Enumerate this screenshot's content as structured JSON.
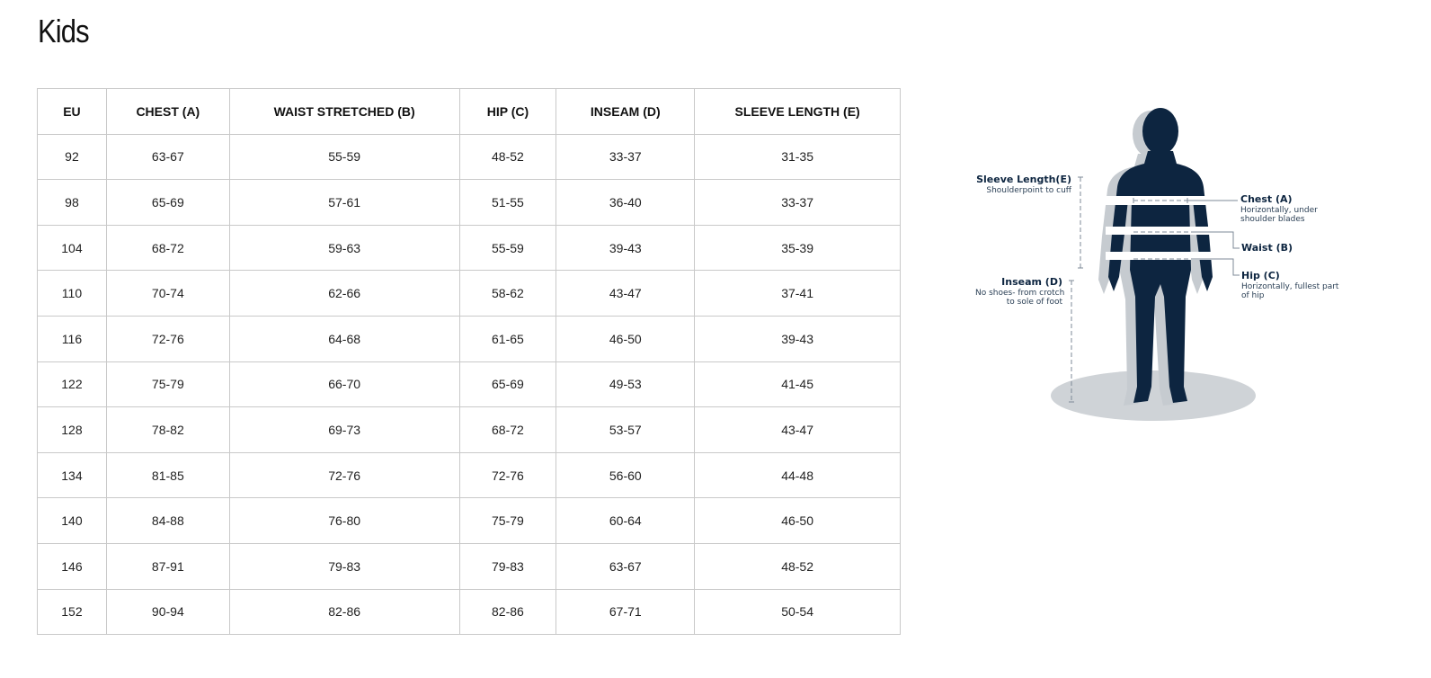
{
  "title": "Kids",
  "table": {
    "headers": [
      "EU",
      "CHEST (A)",
      "WAIST STRETCHED (B)",
      "HIP (C)",
      "INSEAM (D)",
      "SLEEVE LENGTH (E)"
    ],
    "rows": [
      [
        "92",
        "63-67",
        "55-59",
        "48-52",
        "33-37",
        "31-35"
      ],
      [
        "98",
        "65-69",
        "57-61",
        "51-55",
        "36-40",
        "33-37"
      ],
      [
        "104",
        "68-72",
        "59-63",
        "55-59",
        "39-43",
        "35-39"
      ],
      [
        "110",
        "70-74",
        "62-66",
        "58-62",
        "43-47",
        "37-41"
      ],
      [
        "116",
        "72-76",
        "64-68",
        "61-65",
        "46-50",
        "39-43"
      ],
      [
        "122",
        "75-79",
        "66-70",
        "65-69",
        "49-53",
        "41-45"
      ],
      [
        "128",
        "78-82",
        "69-73",
        "68-72",
        "53-57",
        "43-47"
      ],
      [
        "134",
        "81-85",
        "72-76",
        "72-76",
        "56-60",
        "44-48"
      ],
      [
        "140",
        "84-88",
        "76-80",
        "75-79",
        "60-64",
        "46-50"
      ],
      [
        "146",
        "87-91",
        "79-83",
        "79-83",
        "63-67",
        "48-52"
      ],
      [
        "152",
        "90-94",
        "82-86",
        "82-86",
        "67-71",
        "50-54"
      ]
    ]
  },
  "diagram": {
    "sleeve": {
      "title": "Sleeve Length(E)",
      "desc": "Shoulderpoint to cuff"
    },
    "inseam": {
      "title": "Inseam (D)",
      "desc1": "No shoes- from crotch",
      "desc2": "to sole of foot"
    },
    "chest": {
      "title": "Chest (A)",
      "desc1": "Horizontally, under",
      "desc2": "shoulder blades"
    },
    "waist": {
      "title": "Waist (B)"
    },
    "hip": {
      "title": "Hip (C)",
      "desc1": "Horizontally, fullest part",
      "desc2": "of hip"
    },
    "colors": {
      "figure": "#0d2540",
      "shadow": "#c8cdd2",
      "band": "#ffffff",
      "dash": "#7d8a97"
    }
  }
}
